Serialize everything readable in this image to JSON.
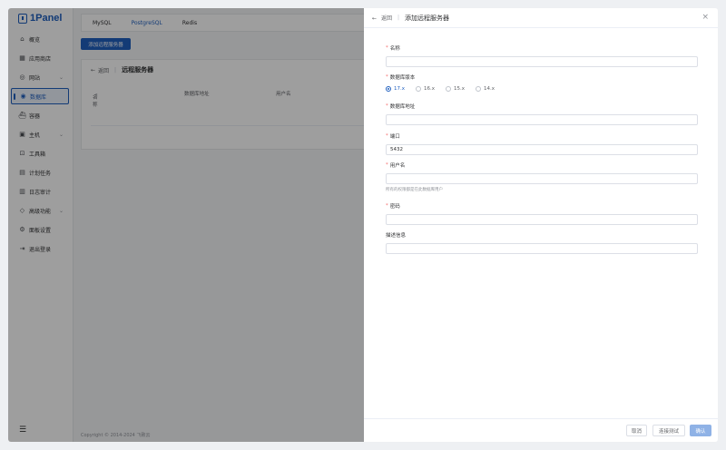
{
  "app": {
    "logo_text": "1Panel"
  },
  "sidebar": {
    "items": [
      {
        "label": "概览",
        "icon": "home-icon"
      },
      {
        "label": "应用商店",
        "icon": "grid-icon"
      },
      {
        "label": "网站",
        "icon": "globe-icon",
        "expandable": true
      },
      {
        "label": "数据库",
        "icon": "database-icon",
        "active": true
      },
      {
        "label": "容器",
        "icon": "container-icon"
      },
      {
        "label": "主机",
        "icon": "host-icon",
        "expandable": true
      },
      {
        "label": "工具箱",
        "icon": "toolbox-icon"
      },
      {
        "label": "计划任务",
        "icon": "calendar-icon"
      },
      {
        "label": "日志审计",
        "icon": "log-icon"
      },
      {
        "label": "高级功能",
        "icon": "diamond-icon",
        "expandable": true
      },
      {
        "label": "面板设置",
        "icon": "settings-icon"
      },
      {
        "label": "退出登录",
        "icon": "logout-icon"
      }
    ]
  },
  "tabs": [
    {
      "label": "MySQL"
    },
    {
      "label": "PostgreSQL",
      "active": true
    },
    {
      "label": "Redis"
    }
  ],
  "main": {
    "add_button": "添加远程服务器",
    "back_label": "返回",
    "page_title": "远程服务器",
    "columns": [
      "名称",
      "数据库地址",
      "用户名"
    ],
    "footer": "Copyright © 2014-2024 飞致云"
  },
  "drawer": {
    "back_label": "返回",
    "title": "添加远程服务器",
    "fields": {
      "name": {
        "label": "名称",
        "value": ""
      },
      "version": {
        "label": "数据库版本",
        "options": [
          "17.x",
          "16.x",
          "15.x",
          "14.x"
        ],
        "selected": "17.x"
      },
      "address": {
        "label": "数据库地址",
        "value": ""
      },
      "port": {
        "label": "端口",
        "value": "5432"
      },
      "username": {
        "label": "用户名",
        "value": "",
        "hint": "所有的权限都是在此数据库用户"
      },
      "password": {
        "label": "密码",
        "value": ""
      },
      "description": {
        "label": "描述信息",
        "value": ""
      }
    },
    "buttons": {
      "cancel": "取消",
      "test": "连接测试",
      "confirm": "确认"
    }
  },
  "colors": {
    "primary": "#1f5fbf",
    "required": "#f56c6c",
    "confirm_disabled": "#8fb2e6"
  }
}
